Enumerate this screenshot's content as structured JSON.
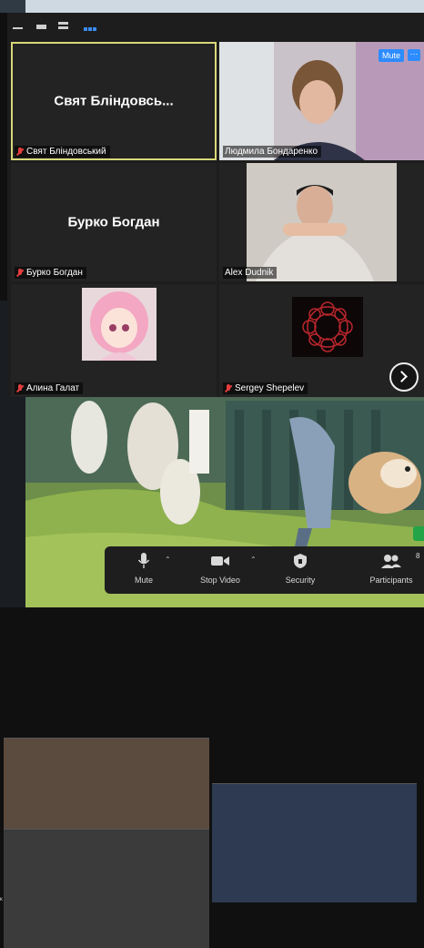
{
  "view_toolbar": {
    "icons": [
      "minimize-icon",
      "float-icon",
      "strip-view-icon",
      "gallery-view-icon"
    ]
  },
  "participants": [
    {
      "display_name": "Свят Бліндовсь...",
      "name_tag": "Свят Бліндовський",
      "video": false,
      "muted": true,
      "active_speaker": true
    },
    {
      "display_name": "",
      "name_tag": "Людмила Бондаренко",
      "video": true,
      "muted": false,
      "hover_buttons": {
        "mute_label": "Mute",
        "more_label": "···"
      }
    },
    {
      "display_name": "Бурко Богдан",
      "name_tag": "Бурко Богдан",
      "video": false,
      "muted": true
    },
    {
      "display_name": "",
      "name_tag": "Alex Dudnik",
      "video": true,
      "muted": false
    },
    {
      "display_name": "",
      "name_tag": "Алина Галат",
      "video": false,
      "muted": true,
      "avatar": "anime-avatar"
    },
    {
      "display_name": "",
      "name_tag": "Sergey Shepelev",
      "video": false,
      "muted": true,
      "avatar": "red-pattern-avatar"
    }
  ],
  "controls": {
    "mute_label": "Mute",
    "stop_video_label": "Stop Video",
    "security_label": "Security",
    "participants_label": "Participants",
    "participants_count": "8"
  },
  "side_strip_label": "к",
  "colors": {
    "accent": "#2d8cff",
    "active_border": "#d9d77a",
    "muted_red": "#e33d3d",
    "bar_bg": "#1e1e1e"
  }
}
